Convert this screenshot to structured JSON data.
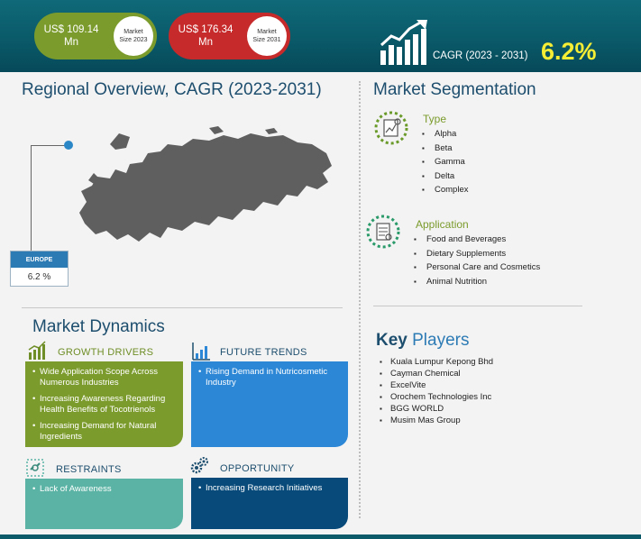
{
  "header": {
    "size_2023": {
      "value_line1": "US$ 109.14",
      "value_line2": "Mn",
      "label_line1": "Market",
      "label_line2": "Size 2023"
    },
    "size_2031": {
      "value_line1": "US$ 176.34",
      "value_line2": "Mn",
      "label_line1": "Market",
      "label_line2": "Size 2031"
    },
    "cagr_label": "CAGR (2023 - 2031)",
    "cagr_value": "6.2%"
  },
  "regional": {
    "title": "Regional Overview, CAGR (2023-2031)",
    "region_name": "EUROPE",
    "region_value": "6.2 %"
  },
  "segmentation": {
    "title": "Market Segmentation",
    "type": {
      "heading": "Type",
      "items": [
        "Alpha",
        "Beta",
        "Gamma",
        "Delta",
        "Complex"
      ]
    },
    "application": {
      "heading": "Application",
      "items": [
        "Food and Beverages",
        "Dietary Supplements",
        "Personal Care and Cosmetics",
        "Animal Nutrition"
      ]
    }
  },
  "key_players": {
    "title_k": "Key",
    "title_rest": " Players",
    "items": [
      "Kuala Lumpur Kepong Bhd",
      "Cayman Chemical",
      "ExcelVite",
      "Orochem Technologies Inc",
      "BGG WORLD",
      "Musim Mas Group"
    ]
  },
  "dynamics": {
    "title": "Market Dynamics",
    "growth_drivers": {
      "heading": "GROWTH DRIVERS",
      "items": [
        "Wide Application Scope Across Numerous Industries",
        "Increasing Awareness Regarding Health Benefits of Tocotrienols",
        "Increasing Demand for Natural Ingredients"
      ]
    },
    "future_trends": {
      "heading": "FUTURE TRENDS",
      "items": [
        "Rising Demand in Nutricosmetic Industry"
      ]
    },
    "restraints": {
      "heading": "RESTRAINTS",
      "items": [
        "Lack of Awareness"
      ]
    },
    "opportunity": {
      "heading": "OPPORTUNITY",
      "items": [
        "Increasing Research Initiatives"
      ]
    }
  },
  "colors": {
    "header_teal": "#0a5a69",
    "green": "#7b9b2c",
    "red": "#c62a2a",
    "blue": "#2c87d6",
    "teal": "#5ab3a4",
    "navy": "#084b7a",
    "cagr_yellow": "#f5ee35",
    "title_blue": "#1d4e6e"
  },
  "icons": {
    "cagr": "growth-chart-icon",
    "type": "chart-document-icon",
    "application": "application-document-icon",
    "growth_drivers": "bar-growth-icon",
    "future_trends": "trend-chart-icon",
    "restraints": "broken-link-icon",
    "opportunity": "gears-icon"
  }
}
